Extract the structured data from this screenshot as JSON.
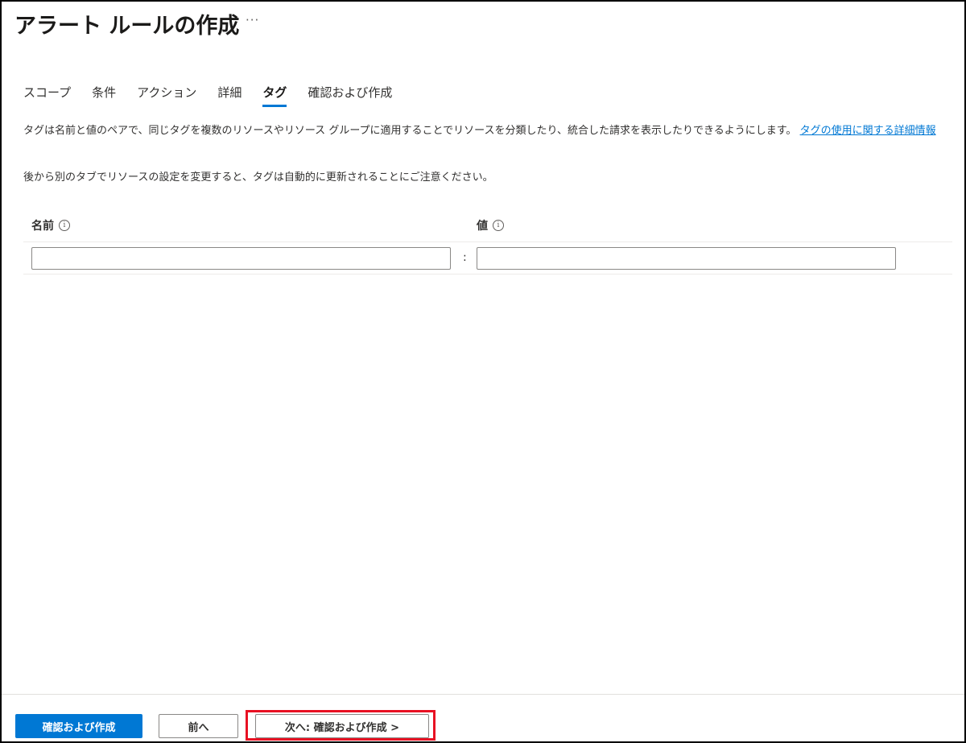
{
  "header": {
    "title": "アラート ルールの作成",
    "more_label": "···"
  },
  "tabs": [
    {
      "label": "スコープ",
      "active": false
    },
    {
      "label": "条件",
      "active": false
    },
    {
      "label": "アクション",
      "active": false
    },
    {
      "label": "詳細",
      "active": false
    },
    {
      "label": "タグ",
      "active": true
    },
    {
      "label": "確認および作成",
      "active": false
    }
  ],
  "main": {
    "description": "タグは名前と値のペアで、同じタグを複数のリソースやリソース グループに適用することでリソースを分類したり、統合した請求を表示したりできるようにします。",
    "learn_more_link": "タグの使用に関する詳細情報",
    "notice": "後から別のタブでリソースの設定を変更すると、タグは自動的に更新されることにご注意ください。"
  },
  "tag_table": {
    "name_header": "名前",
    "value_header": "値",
    "info_icon": "i",
    "separator": ":",
    "name_value": "",
    "value_value": ""
  },
  "footer": {
    "review_create_label": "確認および作成",
    "previous_label": "前へ",
    "next_label": "次へ: 確認および作成 >"
  },
  "colors": {
    "accent": "#0078d4",
    "highlight_border": "#e81123"
  }
}
